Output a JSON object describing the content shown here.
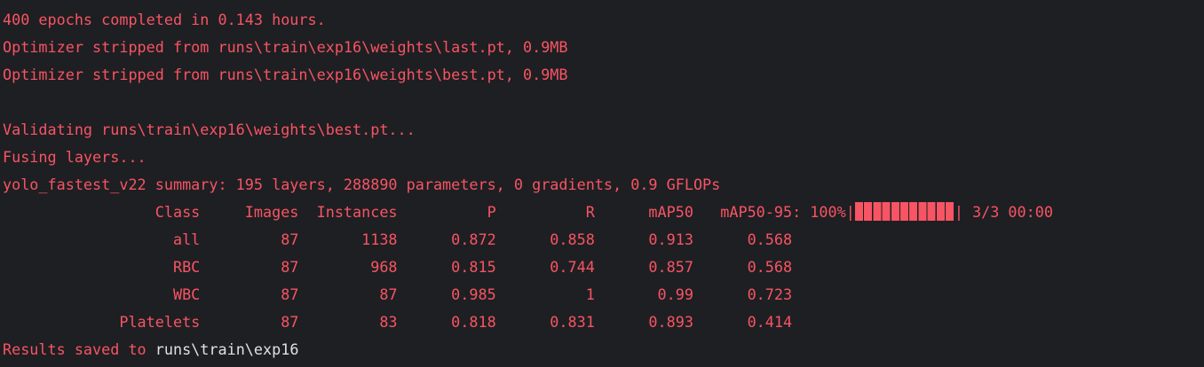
{
  "terminal": {
    "lines": [
      "400 epochs completed in 0.143 hours.",
      "Optimizer stripped from runs\\train\\exp16\\weights\\last.pt, 0.9MB",
      "Optimizer stripped from runs\\train\\exp16\\weights\\best.pt, 0.9MB",
      "",
      "Validating runs\\train\\exp16\\weights\\best.pt...",
      "Fusing layers...",
      "yolo_fastest_v22 summary: 195 layers, 288890 parameters, 0 gradients, 0.9 GFLOPs"
    ],
    "progress": {
      "header_text": "                 Class     Images  Instances          P          R      mAP50   mAP50-95: 100%|",
      "fraction": 1.0,
      "suffix_text": "| 3/3 00:00"
    },
    "table_rows": [
      "                   all         87       1138      0.872      0.858      0.913      0.568",
      "                   RBC         87        968      0.815      0.744      0.857      0.568",
      "                   WBC         87         87      0.985          1       0.99      0.723",
      "             Platelets         87         83      0.818      0.831      0.893      0.414"
    ],
    "results": {
      "prefix": "Results saved to ",
      "path": "runs\\train\\exp16"
    }
  },
  "colors": {
    "background": "#1e1f22",
    "error_text": "#f75464",
    "highlight_text": "#dfe1e5"
  }
}
